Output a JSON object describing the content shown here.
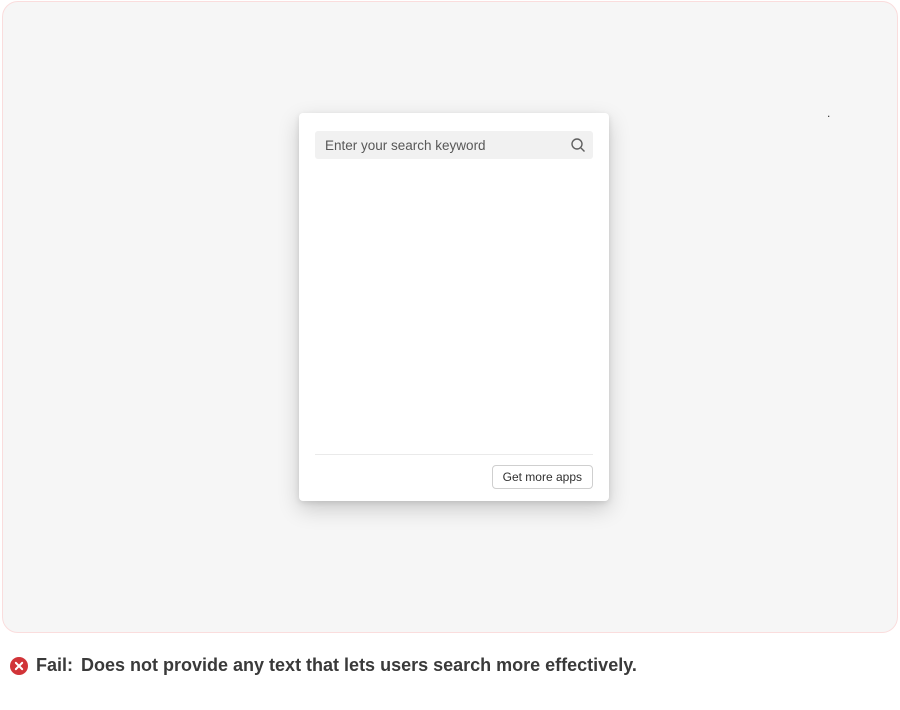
{
  "search": {
    "placeholder": "Enter your search keyword",
    "value": ""
  },
  "footer": {
    "get_more_label": "Get more apps"
  },
  "caption": {
    "status": "Fail:",
    "text": "Does not provide any text that lets users search more effectively."
  }
}
